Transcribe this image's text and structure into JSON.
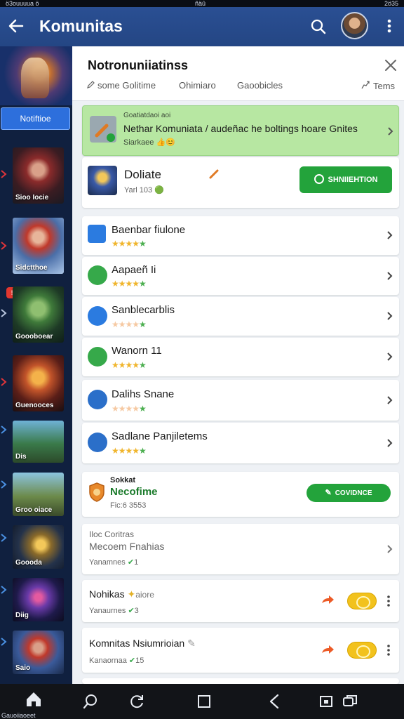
{
  "status_bar": {
    "left": "ö3ouuuua ö",
    "center": "ñäû",
    "right": "2ö35"
  },
  "app_bar": {
    "title": "Komunitas"
  },
  "sidebar": {
    "button_label": "Notiftioe",
    "tiles": [
      {
        "caption": "Sioo Iocie"
      },
      {
        "caption": "Sidctthoe"
      },
      {
        "caption": "Goooboear"
      },
      {
        "caption": "Guenooces"
      },
      {
        "caption": "Dis"
      },
      {
        "caption": "Groo oiace"
      },
      {
        "caption": "Goooda"
      },
      {
        "caption": "Diig"
      },
      {
        "caption": "Saio"
      }
    ],
    "badge_text": "!"
  },
  "panel": {
    "title": "Notronuniiatinss",
    "tabs": [
      {
        "label": "some Golitime"
      },
      {
        "label": "Ohimiaro"
      },
      {
        "label": "Gaoobicles"
      },
      {
        "label": "Tems"
      }
    ],
    "banner": {
      "small": "Goatiatdaoi aoi",
      "text": "Nethar Komuniata / audeñac he boltings hoare Gnites",
      "sub": "Siarkaee 👍😊"
    },
    "feature": {
      "title": "Doliate",
      "sub": "Yarl 103 🟢",
      "button": "SHNIIEHTION"
    },
    "list": [
      {
        "title": "Baenbar fiulone",
        "stars": 4,
        "style": "gold"
      },
      {
        "title": "Aapaeñ Ii",
        "stars": 4,
        "style": "gold"
      },
      {
        "title": "Sanblecarblis",
        "stars": 4,
        "style": "pink"
      },
      {
        "title": "Wanorn 11",
        "stars": 4,
        "style": "gold"
      },
      {
        "title": "Dalihs Snane",
        "stars": 4,
        "style": "pink"
      },
      {
        "title": "Sadlane Panjiletems",
        "stars": 4,
        "style": "gold"
      }
    ],
    "special": {
      "label": "Sokkat",
      "title": "Necofime",
      "sub": "Fic:6 3553",
      "button": "COVIDNCE"
    },
    "plain": {
      "small": "Iloc Coritras",
      "title": "Mecoem Fnahias",
      "sub": "Yanamnes",
      "count": "1"
    },
    "posts": [
      {
        "title": "Nohikas",
        "extra": "aiore",
        "sub": "Yanaurnes",
        "count": "3"
      },
      {
        "title": "Komnitas Nsiumrioian",
        "extra": "",
        "sub": "Kanaornaa",
        "count": "15"
      }
    ]
  },
  "nav": {
    "home_caption": "Gauoiiaoeet"
  },
  "colors": {
    "app_bar": "#2a4f93",
    "accent_green": "#23a33b",
    "banner_green": "#b7e7a2"
  }
}
